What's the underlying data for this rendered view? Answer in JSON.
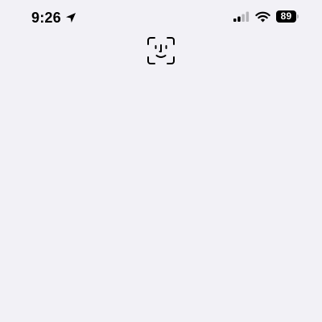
{
  "status_bar": {
    "time": "9:26",
    "battery_level": "89",
    "location_icon": "location-arrow-icon",
    "signal_icon": "cellular-signal-icon",
    "signal_bars_active": 2,
    "signal_bars_total": 4,
    "wifi_icon": "wifi-icon",
    "battery_icon": "battery-icon"
  },
  "main": {
    "faceid_icon": "face-id-icon"
  },
  "colors": {
    "background": "#f2f1f6",
    "foreground": "#000000",
    "inactive_signal": "#b5b5b9"
  }
}
